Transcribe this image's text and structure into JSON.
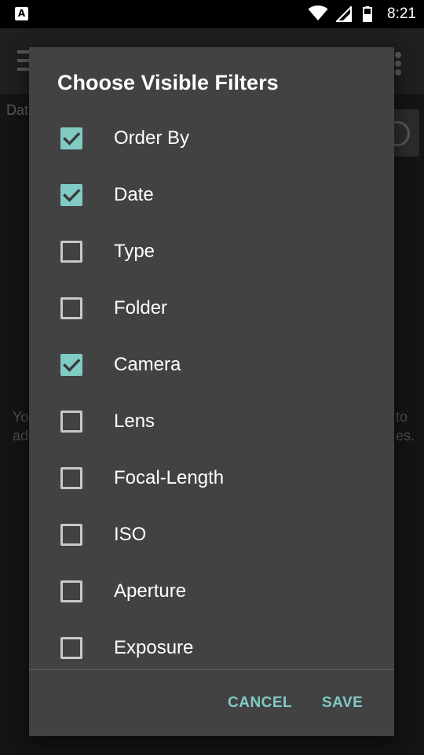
{
  "status_bar": {
    "notification_icon": "A",
    "icons": [
      "wifi-icon",
      "signal-icon",
      "battery-icon"
    ],
    "time": "8:21"
  },
  "background": {
    "app_bar_icons": [
      "menu-icon",
      "overflow-menu-icon"
    ],
    "filter_label": "Dat",
    "hint_left": [
      "Yo",
      "ad"
    ],
    "hint_right": [
      "to",
      "es."
    ]
  },
  "dialog": {
    "title": "Choose Visible Filters",
    "filters": [
      {
        "label": "Order By",
        "checked": true
      },
      {
        "label": "Date",
        "checked": true
      },
      {
        "label": "Type",
        "checked": false
      },
      {
        "label": "Folder",
        "checked": false
      },
      {
        "label": "Camera",
        "checked": true
      },
      {
        "label": "Lens",
        "checked": false
      },
      {
        "label": "Focal-Length",
        "checked": false
      },
      {
        "label": "ISO",
        "checked": false
      },
      {
        "label": "Aperture",
        "checked": false
      },
      {
        "label": "Exposure",
        "checked": false
      }
    ],
    "cancel_label": "CANCEL",
    "save_label": "SAVE"
  },
  "colors": {
    "accent": "#80cbc4",
    "dialog_background": "#424242",
    "checkbox_unchecked": "#c8c8c8",
    "text_primary": "#ffffff"
  }
}
